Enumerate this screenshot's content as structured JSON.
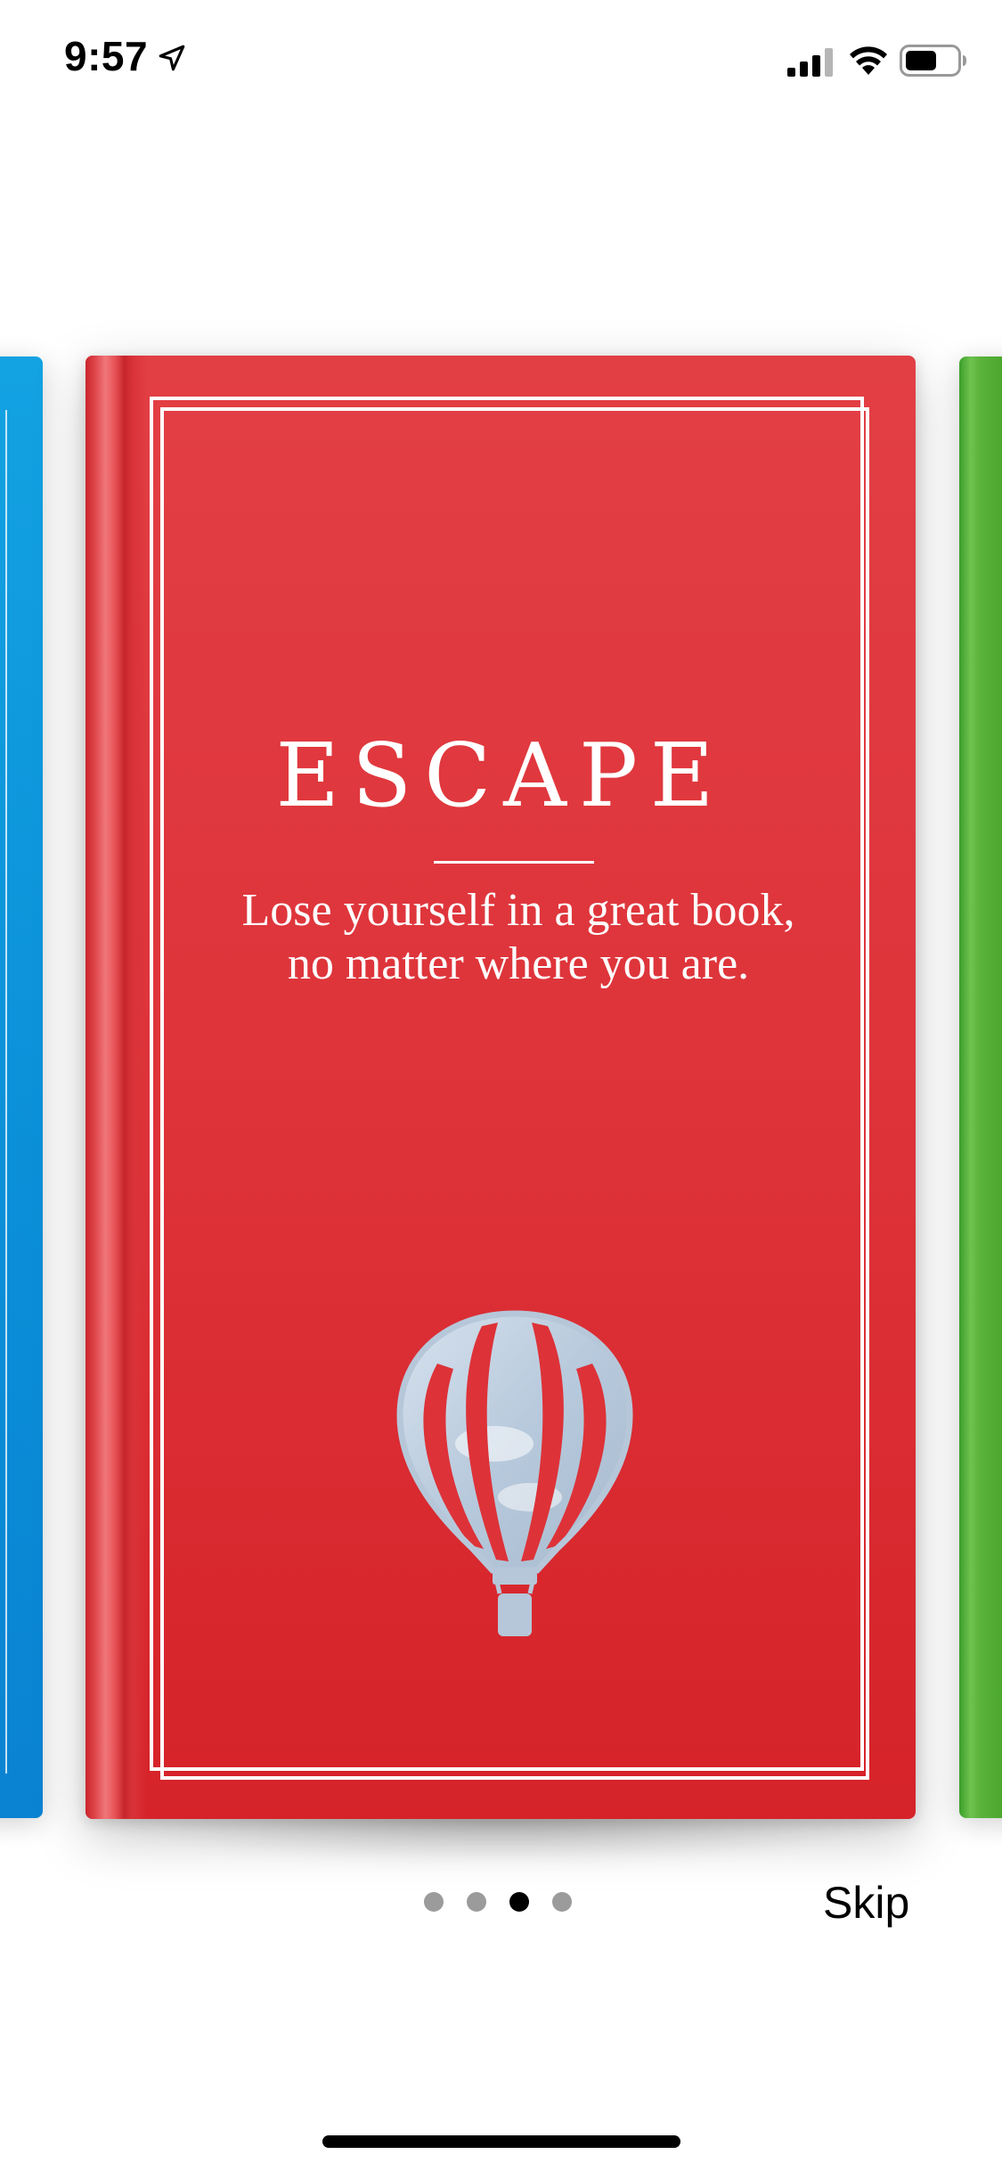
{
  "status_bar": {
    "time": "9:57",
    "icons": [
      "location-arrow-icon",
      "cellular-signal-icon",
      "wifi-icon",
      "battery-icon"
    ]
  },
  "carousel": {
    "books": [
      {
        "position": "left",
        "color": "#0b90d8"
      },
      {
        "position": "center",
        "color": "#dd3238",
        "title": "ESCAPE",
        "tagline": "Lose yourself in a great book, no matter where you are.",
        "illustration": "hot-air-balloon-icon"
      },
      {
        "position": "right",
        "color": "#4aa72c"
      }
    ]
  },
  "pager": {
    "count": 4,
    "active_index": 2
  },
  "skip_label": "Skip",
  "colors": {
    "active_dot": "#000000",
    "inactive_dot": "#9b9b9b",
    "text_on_cover": "#ffffff"
  }
}
